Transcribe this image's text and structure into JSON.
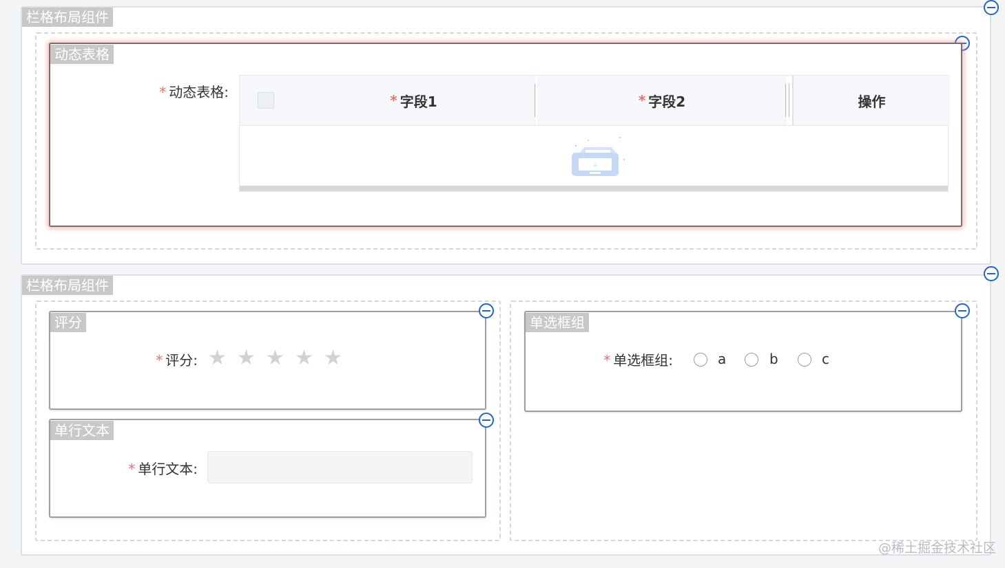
{
  "grid_tag": "栏格布局组件",
  "dynamic_table": {
    "tag": "动态表格",
    "label": "动态表格:",
    "columns": [
      "字段1",
      "字段2"
    ],
    "action_header": "操作"
  },
  "rating": {
    "tag": "评分",
    "label": "评分:",
    "max_stars": 5,
    "value": 0
  },
  "radio_group": {
    "tag": "单选框组",
    "label": "单选框组:",
    "options": [
      "a",
      "b",
      "c"
    ]
  },
  "text_input": {
    "tag": "单行文本",
    "label": "单行文本:",
    "value": ""
  },
  "watermark": "@稀土掘金技术社区",
  "colors": {
    "accent": "#1e63d6",
    "required": "#f56c6c",
    "tag_bg": "#c8c8c8",
    "active_glow": "#ff7878"
  }
}
